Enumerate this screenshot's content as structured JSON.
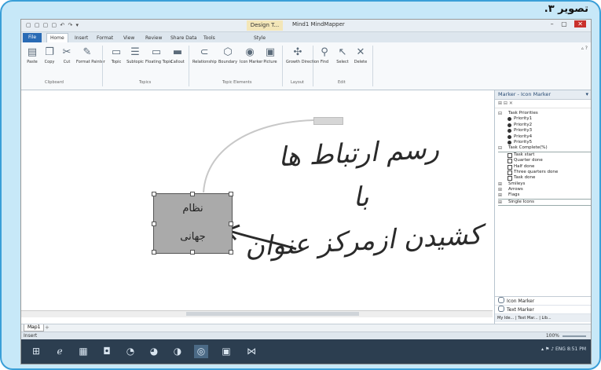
{
  "caption": "تصویر ۳.",
  "window": {
    "quick_access": "▢ ▢ ▢ ▢ ↶ ↷ ▾",
    "tool_context": "Design T...",
    "title": "Mind1  MindMapper",
    "minimize": "–",
    "maximize": "▢",
    "close": "✕"
  },
  "tabs": [
    "File",
    "Home",
    "Insert",
    "Format",
    "View",
    "Review",
    "Share Data",
    "Tools",
    "Style"
  ],
  "ribbon": {
    "buttons": [
      {
        "icon": "paste-icon",
        "glyph": "▤",
        "label": "Paste"
      },
      {
        "icon": "copy-icon",
        "glyph": "❐",
        "label": "Copy"
      },
      {
        "icon": "cut-icon",
        "glyph": "✂",
        "label": "Cut"
      },
      {
        "icon": "format-painter-icon",
        "glyph": "✎",
        "label": "Format Painter"
      },
      {
        "icon": "topic-icon",
        "glyph": "▭",
        "label": "Topic"
      },
      {
        "icon": "subtopic-icon",
        "glyph": "☰",
        "label": "Subtopic"
      },
      {
        "icon": "floating-topic-icon",
        "glyph": "▭",
        "label": "Floating Topic"
      },
      {
        "icon": "callout-icon",
        "glyph": "▬",
        "label": "Callout"
      },
      {
        "icon": "relationship-icon",
        "glyph": "⊂",
        "label": "Relationship"
      },
      {
        "icon": "boundary-icon",
        "glyph": "⬡",
        "label": "Boundary"
      },
      {
        "icon": "icon-marker-icon",
        "glyph": "◉",
        "label": "Icon Marker"
      },
      {
        "icon": "picture-icon",
        "glyph": "▣",
        "label": "Picture"
      },
      {
        "icon": "growth-direction-icon",
        "glyph": "✣",
        "label": "Growth Direction"
      },
      {
        "icon": "find-icon",
        "glyph": "⚲",
        "label": "Find"
      },
      {
        "icon": "select-icon",
        "glyph": "↖",
        "label": "Select"
      },
      {
        "icon": "delete-icon",
        "glyph": "✕",
        "label": "Delete"
      }
    ],
    "groups": [
      "Clipboard",
      "Topics",
      "Topic Elements",
      "Layout",
      "Edit"
    ],
    "collapse": "▵ ?"
  },
  "canvas": {
    "central_topic_line1": "نظام",
    "central_topic_line2": "جهانی",
    "note_line1": "رسم ارتباط ها",
    "note_line2": "با",
    "note_line3": "کشیدن ازمرکز عنوان"
  },
  "panel": {
    "title": "Marker - Icon Marker",
    "pin": "▾",
    "tools": "⊞ ⊟  ✕",
    "tree": [
      {
        "kind": "cat",
        "label": "Task Priorities",
        "exp": "⊟"
      },
      {
        "kind": "leaf",
        "label": "Priority1"
      },
      {
        "kind": "leaf",
        "label": "Priority2"
      },
      {
        "kind": "leaf",
        "label": "Priority3"
      },
      {
        "kind": "leaf",
        "label": "Priority4"
      },
      {
        "kind": "leaf",
        "label": "Priority5"
      },
      {
        "kind": "cat",
        "label": "Task Complete(%)",
        "exp": "⊟",
        "line": true
      },
      {
        "kind": "box",
        "label": "Task start"
      },
      {
        "kind": "box",
        "label": "Quarter done"
      },
      {
        "kind": "box",
        "label": "Half done"
      },
      {
        "kind": "box",
        "label": "Three quarters done"
      },
      {
        "kind": "box",
        "label": "Task done"
      },
      {
        "kind": "cat",
        "label": "Smileys",
        "exp": "⊞"
      },
      {
        "kind": "cat",
        "label": "Arrows",
        "exp": "⊞"
      },
      {
        "kind": "cat",
        "label": "Flags",
        "exp": "⊞",
        "line": true
      },
      {
        "kind": "cat",
        "label": "Single Icons",
        "exp": "⊞",
        "line": true
      }
    ],
    "bottom_icon_marker": "Icon Marker",
    "bottom_text_marker": "Text Marker",
    "bottom_tabs": "My Ide... | Text Mar... | Lib..."
  },
  "sheet": {
    "tab": "Map1",
    "add": "+"
  },
  "status": {
    "text": "Insert",
    "zoom": "100%"
  },
  "taskbar": {
    "icons": [
      {
        "name": "start-icon",
        "glyph": "⊞"
      },
      {
        "name": "ie-icon",
        "glyph": "ℯ"
      },
      {
        "name": "explorer-icon",
        "glyph": "▦"
      },
      {
        "name": "store-icon",
        "glyph": "◘"
      },
      {
        "name": "media-icon",
        "glyph": "◔"
      },
      {
        "name": "firefox-icon",
        "glyph": "◕"
      },
      {
        "name": "app-icon",
        "glyph": "◑"
      },
      {
        "name": "mindmapper-icon",
        "glyph": "◎"
      },
      {
        "name": "word-icon",
        "glyph": "▣"
      },
      {
        "name": "vs-icon",
        "glyph": "⋈"
      }
    ],
    "tray": "▴ ⚑ ♪ ENG  8:51 PM"
  }
}
